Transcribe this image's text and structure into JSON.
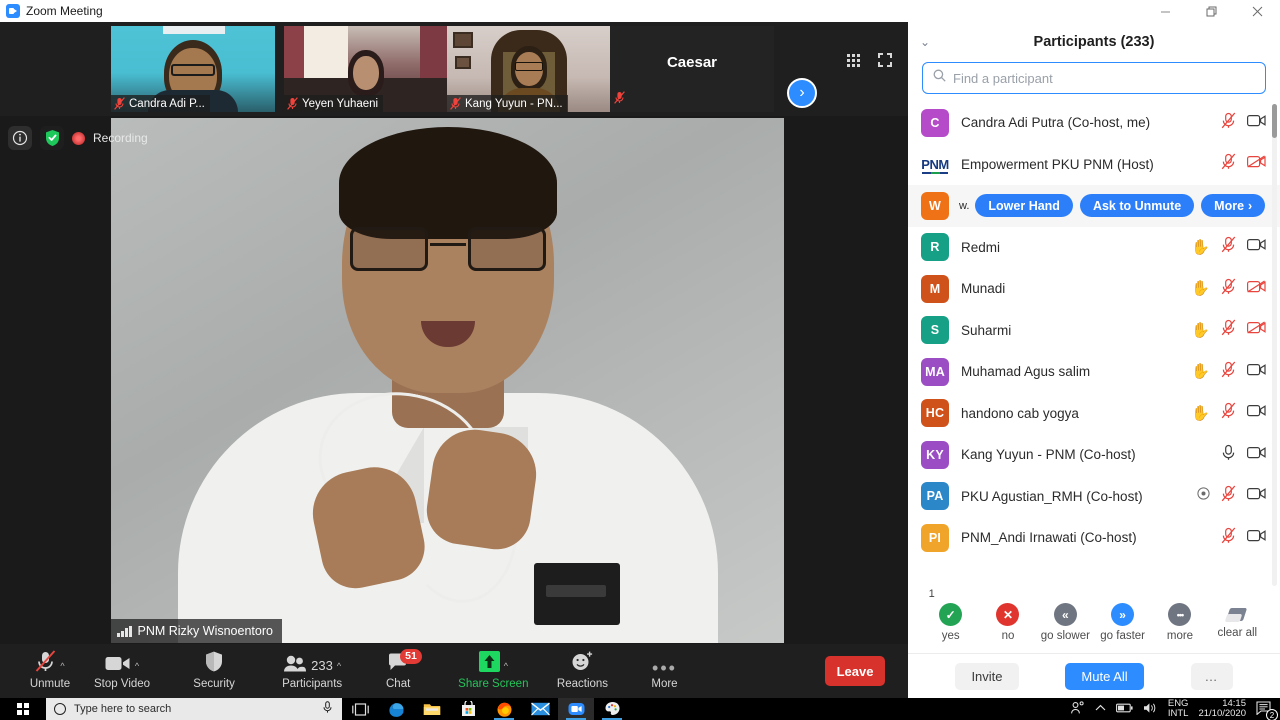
{
  "window": {
    "title": "Zoom Meeting",
    "app_icon": "zoom-camera-icon",
    "minimize": "minimize-icon",
    "restore": "restore-icon",
    "close": "close-icon"
  },
  "status": {
    "info_icon": "info-icon",
    "encryption_icon": "shield-check-icon",
    "recording_label": "Recording"
  },
  "thumbnails": [
    {
      "name": "Candra Adi P...",
      "muted": true
    },
    {
      "name": "Yeyen Yuhaeni",
      "muted": true
    },
    {
      "name": "Kang Yuyun - PN...",
      "muted": true
    },
    {
      "name": "Caesar",
      "muted": true,
      "no_video": true
    }
  ],
  "view_controls": {
    "grid_icon": "gallery-view-icon",
    "fullscreen_icon": "fullscreen-icon",
    "next_page_icon": "chevron-right-icon"
  },
  "active_speaker": {
    "name": "PNM Rizky Wisnoentoro",
    "signal_icon": "signal-strength-icon"
  },
  "toolbar": {
    "items": [
      {
        "label": "Unmute",
        "icon": "microphone-muted-icon",
        "has_caret": true
      },
      {
        "label": "Stop Video",
        "icon": "video-camera-icon",
        "has_caret": true
      },
      {
        "label": "Security",
        "icon": "shield-icon",
        "has_caret": false
      },
      {
        "label": "Participants",
        "icon": "people-icon",
        "count": "233",
        "has_caret": true
      },
      {
        "label": "Chat",
        "icon": "chat-bubble-icon",
        "badge": "51",
        "has_caret": false
      },
      {
        "label": "Share Screen",
        "icon": "share-screen-icon",
        "has_caret": true,
        "green": true
      },
      {
        "label": "Reactions",
        "icon": "smiley-plus-icon",
        "has_caret": false
      },
      {
        "label": "More",
        "icon": "ellipsis-icon",
        "has_caret": false
      }
    ],
    "leave_label": "Leave"
  },
  "panel": {
    "collapse_icon": "chevron-down-icon",
    "title": "Participants (233)",
    "search_placeholder": "Find a participant",
    "search_value": "",
    "search_icon": "search-icon",
    "participants": [
      {
        "initials": "C",
        "color": "#b54bc9",
        "name": "Candra Adi Putra (Co-host, me)",
        "hand": false,
        "mic": "muted",
        "video": "on"
      },
      {
        "initials": "PNM",
        "color": "#ffffff",
        "logo": true,
        "name": "Empowerment PKU PNM (Host)",
        "hand": false,
        "mic": "muted",
        "video": "off"
      },
      {
        "initials": "W",
        "color": "#ef7316",
        "name": "w.",
        "hand": true,
        "actions": [
          "Lower Hand",
          "Ask to Unmute",
          "More"
        ],
        "highlight": true
      },
      {
        "initials": "R",
        "color": "#16a085",
        "name": "Redmi",
        "hand": true,
        "mic": "muted",
        "video": "on"
      },
      {
        "initials": "M",
        "color": "#d0521b",
        "name": "Munadi",
        "hand": true,
        "mic": "muted",
        "video": "off"
      },
      {
        "initials": "S",
        "color": "#16a085",
        "name": "Suharmi",
        "hand": true,
        "mic": "muted",
        "video": "off"
      },
      {
        "initials": "MA",
        "color": "#9b4ec4",
        "name": "Muhamad Agus salim",
        "hand": true,
        "mic": "muted",
        "video": "on"
      },
      {
        "initials": "HC",
        "color": "#d0521b",
        "name": "handono cab yogya",
        "hand": true,
        "mic": "muted",
        "video": "on"
      },
      {
        "initials": "KY",
        "color": "#9b4ec4",
        "name": "Kang Yuyun - PNM (Co-host)",
        "hand": false,
        "mic": "on",
        "video": "on"
      },
      {
        "initials": "PA",
        "color": "#2b87c8",
        "name": "PKU Agustian_RMH (Co-host)",
        "hand": false,
        "record": true,
        "mic": "muted",
        "video": "on"
      },
      {
        "initials": "PI",
        "color": "#f0a52a",
        "name": "PNM_Andi Irnawati (Co-host)",
        "hand": false,
        "mic": "muted",
        "video": "on"
      }
    ],
    "reactions": [
      {
        "label": "yes",
        "glyph": "✓",
        "color": "#23a455",
        "count": "1"
      },
      {
        "label": "no",
        "glyph": "✕",
        "color": "#e0352e",
        "count": ""
      },
      {
        "label": "go slower",
        "glyph": "«",
        "color": "#6f7682",
        "count": ""
      },
      {
        "label": "go faster",
        "glyph": "»",
        "color": "#2d8cff",
        "count": ""
      },
      {
        "label": "more",
        "glyph": "•••",
        "color": "#6f7682",
        "count": ""
      },
      {
        "label": "clear all",
        "glyph": "eraser-icon",
        "color": "",
        "count": ""
      }
    ],
    "footer": {
      "invite": "Invite",
      "mute_all": "Mute All",
      "more": "…"
    }
  },
  "taskbar": {
    "start_icon": "windows-start-icon",
    "search_placeholder": "Type here to search",
    "mic_icon": "microphone-icon",
    "apps": [
      {
        "icon": "task-view-icon",
        "name": "task-view"
      },
      {
        "icon": "edge-icon",
        "name": "edge"
      },
      {
        "icon": "file-explorer-icon",
        "name": "file-explorer"
      },
      {
        "icon": "microsoft-store-icon",
        "name": "microsoft-store"
      },
      {
        "icon": "firefox-icon",
        "name": "firefox"
      },
      {
        "icon": "mail-icon",
        "name": "mail"
      },
      {
        "icon": "zoom-icon",
        "name": "zoom"
      },
      {
        "icon": "paint-icon",
        "name": "paint"
      }
    ],
    "tray": {
      "people_icon": "people-icon",
      "chevron_icon": "chevron-up-icon",
      "battery_icon": "battery-icon",
      "volume_icon": "volume-icon",
      "lang_line1": "ENG",
      "lang_line2": "INTL",
      "time": "14:15",
      "date": "21/10/2020",
      "notification_count": "2"
    }
  }
}
